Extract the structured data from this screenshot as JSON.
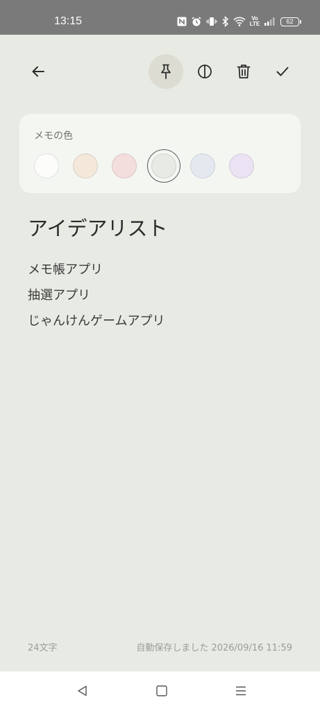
{
  "status_bar": {
    "time": "13:15",
    "battery_level": "62",
    "network_label": "Vo LTE"
  },
  "toolbar": {
    "back_icon": "arrow-left-icon",
    "pin_icon": "pin-icon",
    "pin_active": true,
    "theme_icon": "contrast-icon",
    "delete_icon": "trash-icon",
    "done_icon": "check-icon"
  },
  "color_picker": {
    "label": "メモの色",
    "selected_index": 3,
    "colors": [
      "#fcfcfa",
      "#f3e8da",
      "#f3dedd",
      "#e8ebe4",
      "#e4e9f0",
      "#ebe3f3"
    ]
  },
  "note": {
    "title": "アイデアリスト",
    "lines": [
      "メモ帳アプリ",
      "抽選アプリ",
      "じゃんけんゲームアプリ"
    ]
  },
  "footer": {
    "char_count": "24文字",
    "autosave": "自動保存しました 2026/09/16 11:59"
  },
  "nav_bar": {
    "back_icon": "triangle-back-icon",
    "home_icon": "square-home-icon",
    "menu_icon": "menu-lines-icon"
  },
  "colors": {
    "background": "#e8ebe4",
    "card": "#f4f6f2",
    "status_bar": "#7a7a7a",
    "active_button": "#dcdcd3"
  }
}
